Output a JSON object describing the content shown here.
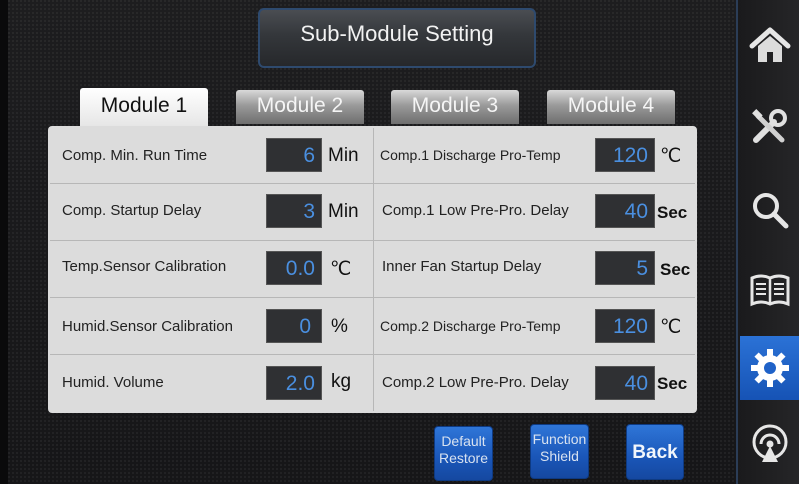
{
  "title": "Sub-Module Setting",
  "tabs": [
    {
      "label": "Module 1",
      "active": true
    },
    {
      "label": "Module 2",
      "active": false
    },
    {
      "label": "Module 3",
      "active": false
    },
    {
      "label": "Module 4",
      "active": false
    }
  ],
  "left_settings": [
    {
      "label": "Comp. Min. Run Time",
      "value": "6",
      "unit": "Min"
    },
    {
      "label": "Comp. Startup Delay",
      "value": "3",
      "unit": "Min"
    },
    {
      "label": "Temp.Sensor Calibration",
      "value": "0.0",
      "unit": "℃"
    },
    {
      "label": "Humid.Sensor Calibration",
      "value": "0",
      "unit": "%"
    },
    {
      "label": "Humid. Volume",
      "value": "2.0",
      "unit": "kg"
    }
  ],
  "right_settings": [
    {
      "label": "Comp.1 Discharge Pro-Temp",
      "value": "120",
      "unit": "℃"
    },
    {
      "label": "Comp.1 Low Pre-Pro. Delay",
      "value": "40",
      "unit": "Sec"
    },
    {
      "label": "Inner Fan Startup Delay",
      "value": "5",
      "unit": "Sec"
    },
    {
      "label": "Comp.2 Discharge Pro-Temp",
      "value": "120",
      "unit": "℃"
    },
    {
      "label": "Comp.2 Low Pre-Pro. Delay",
      "value": "40",
      "unit": "Sec"
    }
  ],
  "buttons": {
    "default_restore_line1": "Default",
    "default_restore_line2": "Restore",
    "function_shield_line1": "Function",
    "function_shield_line2": "Shield",
    "back": "Back"
  },
  "sidebar": [
    {
      "icon": "home-icon",
      "active": false
    },
    {
      "icon": "tools-icon",
      "active": false
    },
    {
      "icon": "search-icon",
      "active": false
    },
    {
      "icon": "book-icon",
      "active": false
    },
    {
      "icon": "gear-icon",
      "active": true
    },
    {
      "icon": "signal-icon",
      "active": false
    }
  ],
  "colors": {
    "accent_blue": "#1f62c8",
    "value_text": "#4a8fe0",
    "panel": "#dcdcdc"
  }
}
